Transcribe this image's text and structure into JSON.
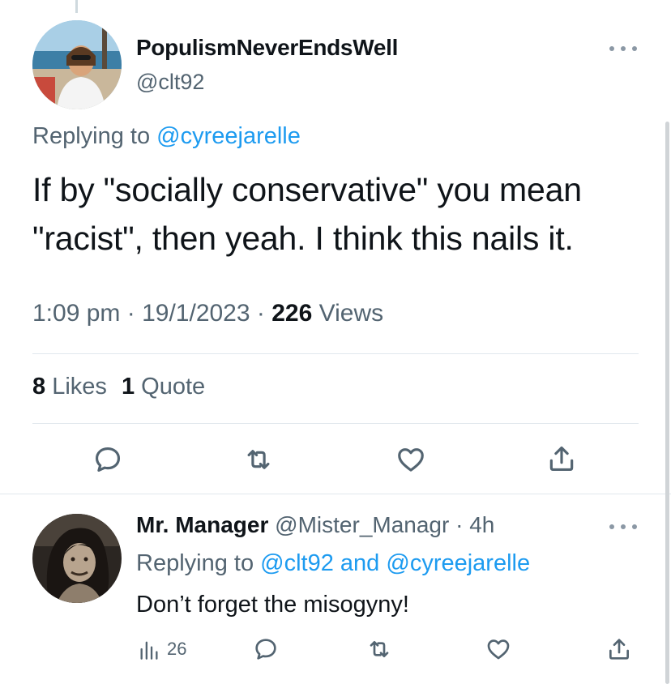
{
  "main_tweet": {
    "display_name": "PopulismNeverEndsWell",
    "handle": "@clt92",
    "replying_prefix": "Replying to",
    "replying_to": "@cyreejarelle",
    "text": "If by \"socially conservative\" you mean \"racist\", then yeah. I think this nails it.",
    "time": "1:09 pm",
    "date": "19/1/2023",
    "views_count": "226",
    "views_label": "Views",
    "likes_count": "8",
    "likes_label": "Likes",
    "quotes_count": "1",
    "quotes_label": "Quote"
  },
  "reply_tweet": {
    "display_name": "Mr. Manager",
    "handle": "@Mister_Managr",
    "age": "4h",
    "replying_prefix": "Replying to",
    "replying_to_1": "@clt92",
    "replying_joiner": "and",
    "replying_to_2": "@cyreejarelle",
    "text": "Don’t forget the misogyny!",
    "views_count": "26"
  },
  "icons": {
    "reply": "speech-bubble-icon",
    "retweet": "retweet-icon",
    "like": "heart-icon",
    "share": "share-icon",
    "views": "bar-chart-icon",
    "more": "more-dots-icon"
  },
  "colors": {
    "text": "#0f1419",
    "secondary": "#536471",
    "link": "#1d9bf0",
    "divider": "#e1e8ed"
  }
}
